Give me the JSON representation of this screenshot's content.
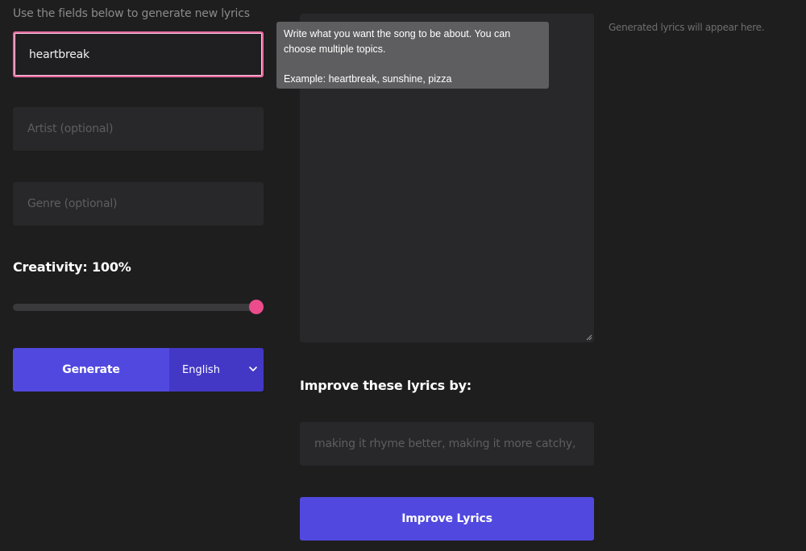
{
  "intro_text": "Use the fields below to generate new lyrics",
  "topic": {
    "value": "heartbreak",
    "placeholder": ""
  },
  "artist": {
    "placeholder": "Artist (optional)"
  },
  "genre": {
    "placeholder": "Genre (optional)"
  },
  "creativity": {
    "label": "Creativity:",
    "value_text": "100%",
    "value": 100
  },
  "generate": {
    "label": "Generate"
  },
  "language": {
    "selected": "English"
  },
  "tooltip": {
    "line1": "Write what you want the song to be about. You can choose multiple topics.",
    "example": "Example: heartbreak, sunshine, pizza"
  },
  "output": {
    "placeholder": "Generated lyrics will appear here."
  },
  "improve": {
    "label": "Improve these lyrics by:",
    "placeholder": "making it rhyme better, making it more catchy, etc.",
    "button_label": "Improve Lyrics"
  },
  "colors": {
    "accent": "#5149df",
    "accent_dark": "#4338c6",
    "focus_border": "#e56a9f",
    "slider_thumb": "#ec4c8c",
    "background": "#1e1e1f",
    "field": "#28282a"
  },
  "icons": {
    "language_dropdown": "chevron-down-icon",
    "textarea_resize": "resize-grip-icon"
  }
}
